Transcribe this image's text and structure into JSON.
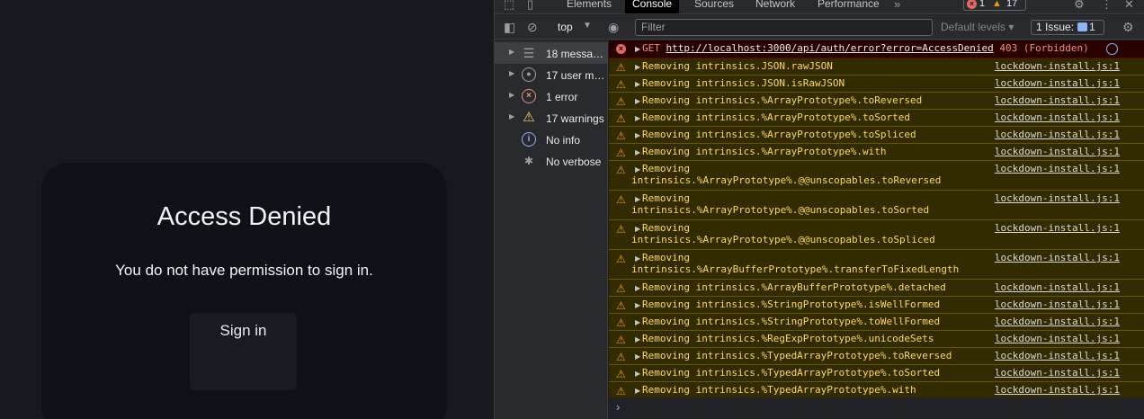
{
  "page": {
    "card_title": "Access Denied",
    "card_message": "You do not have permission to sign in.",
    "signin_label": "Sign in"
  },
  "devtools": {
    "tabs": [
      "Elements",
      "Console",
      "Sources",
      "Network",
      "Performance"
    ],
    "active_tab": "Console",
    "more_tabs": "»",
    "error_count": "1",
    "warning_count": "17",
    "toolbar": {
      "context": "top",
      "filter_placeholder": "Filter",
      "levels_label": "Default levels",
      "issues_label": "1 Issue:",
      "issues_count": "1"
    },
    "sidebar": [
      {
        "label": "18 messa…",
        "icon": "list-icon"
      },
      {
        "label": "17 user m…",
        "icon": "user-icon"
      },
      {
        "label": "1 error",
        "icon": "error-icon"
      },
      {
        "label": "17 warnings",
        "icon": "warning-icon"
      },
      {
        "label": "No info",
        "icon": "info-icon"
      },
      {
        "label": "No verbose",
        "icon": "bug-icon"
      }
    ],
    "error_row": {
      "method": "GET",
      "url": "http://localhost:3000/api/auth/error?error=AccessDenied",
      "status": "403 (Forbidden)"
    },
    "warnings": [
      {
        "line1": "Removing intrinsics.JSON.rawJSON",
        "line2": "",
        "source": "lockdown-install.js:1"
      },
      {
        "line1": "Removing intrinsics.JSON.isRawJSON",
        "line2": "",
        "source": "lockdown-install.js:1"
      },
      {
        "line1": "Removing intrinsics.%ArrayPrototype%.toReversed",
        "line2": "",
        "source": "lockdown-install.js:1"
      },
      {
        "line1": "Removing intrinsics.%ArrayPrototype%.toSorted",
        "line2": "",
        "source": "lockdown-install.js:1"
      },
      {
        "line1": "Removing intrinsics.%ArrayPrototype%.toSpliced",
        "line2": "",
        "source": "lockdown-install.js:1"
      },
      {
        "line1": "Removing intrinsics.%ArrayPrototype%.with",
        "line2": "",
        "source": "lockdown-install.js:1"
      },
      {
        "line1": "Removing",
        "line2": "intrinsics.%ArrayPrototype%.@@unscopables.toReversed",
        "source": "lockdown-install.js:1"
      },
      {
        "line1": "Removing",
        "line2": "intrinsics.%ArrayPrototype%.@@unscopables.toSorted",
        "source": "lockdown-install.js:1"
      },
      {
        "line1": "Removing",
        "line2": "intrinsics.%ArrayPrototype%.@@unscopables.toSpliced",
        "source": "lockdown-install.js:1"
      },
      {
        "line1": "Removing",
        "line2": "intrinsics.%ArrayBufferPrototype%.transferToFixedLength",
        "source": "lockdown-install.js:1"
      },
      {
        "line1": "Removing intrinsics.%ArrayBufferPrototype%.detached",
        "line2": "",
        "source": "lockdown-install.js:1"
      },
      {
        "line1": "Removing intrinsics.%StringPrototype%.isWellFormed",
        "line2": "",
        "source": "lockdown-install.js:1"
      },
      {
        "line1": "Removing intrinsics.%StringPrototype%.toWellFormed",
        "line2": "",
        "source": "lockdown-install.js:1"
      },
      {
        "line1": "Removing intrinsics.%RegExpPrototype%.unicodeSets",
        "line2": "",
        "source": "lockdown-install.js:1"
      },
      {
        "line1": "Removing intrinsics.%TypedArrayPrototype%.toReversed",
        "line2": "",
        "source": "lockdown-install.js:1"
      },
      {
        "line1": "Removing intrinsics.%TypedArrayPrototype%.toSorted",
        "line2": "",
        "source": "lockdown-install.js:1"
      },
      {
        "line1": "Removing intrinsics.%TypedArrayPrototype%.with",
        "line2": "",
        "source": "lockdown-install.js:1"
      }
    ],
    "prompt_symbol": "›"
  }
}
